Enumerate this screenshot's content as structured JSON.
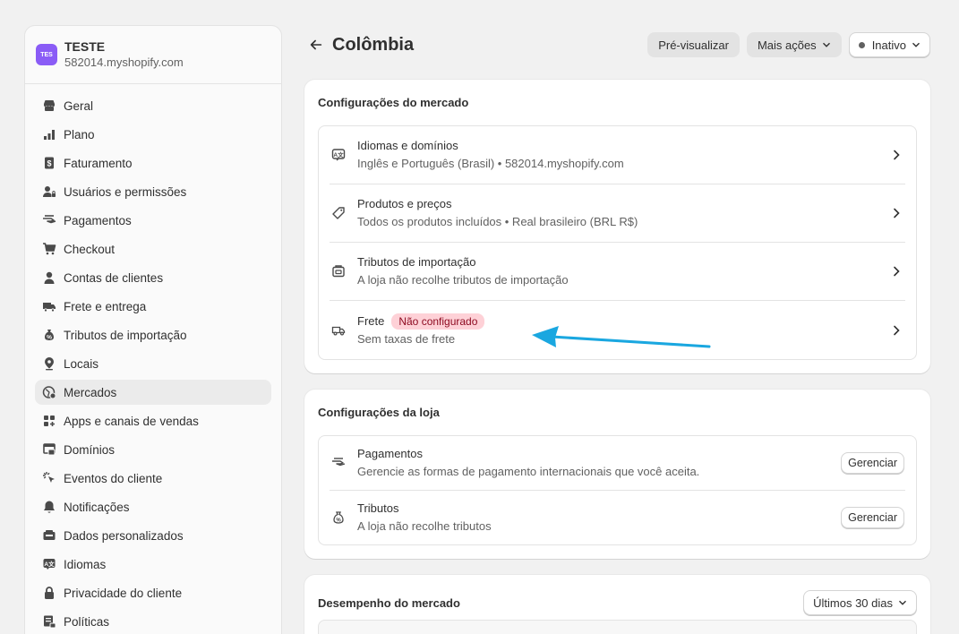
{
  "store": {
    "avatar": "TES",
    "name": "TESTE",
    "domain": "582014.myshopify.com"
  },
  "sidebar": {
    "items": [
      {
        "label": "Geral",
        "icon": "store-icon"
      },
      {
        "label": "Plano",
        "icon": "plan-icon"
      },
      {
        "label": "Faturamento",
        "icon": "billing-icon"
      },
      {
        "label": "Usuários e permissões",
        "icon": "users-icon"
      },
      {
        "label": "Pagamentos",
        "icon": "payments-icon"
      },
      {
        "label": "Checkout",
        "icon": "cart-icon"
      },
      {
        "label": "Contas de clientes",
        "icon": "person-icon"
      },
      {
        "label": "Frete e entrega",
        "icon": "truck-icon"
      },
      {
        "label": "Tributos de importação",
        "icon": "tax-icon"
      },
      {
        "label": "Locais",
        "icon": "location-icon"
      },
      {
        "label": "Mercados",
        "icon": "globe-icon",
        "active": true
      },
      {
        "label": "Apps e canais de vendas",
        "icon": "apps-icon"
      },
      {
        "label": "Domínios",
        "icon": "domain-icon"
      },
      {
        "label": "Eventos do cliente",
        "icon": "cursor-icon"
      },
      {
        "label": "Notificações",
        "icon": "bell-icon"
      },
      {
        "label": "Dados personalizados",
        "icon": "data-icon"
      },
      {
        "label": "Idiomas",
        "icon": "language-icon"
      },
      {
        "label": "Privacidade do cliente",
        "icon": "lock-icon"
      },
      {
        "label": "Políticas",
        "icon": "policy-icon"
      }
    ]
  },
  "header": {
    "title": "Colômbia",
    "preview_label": "Pré-visualizar",
    "more_actions_label": "Mais ações",
    "status_label": "Inativo"
  },
  "market_settings": {
    "title": "Configurações do mercado",
    "rows": [
      {
        "title": "Idiomas e domínios",
        "subtitle": "Inglês e Português (Brasil) • 582014.myshopify.com"
      },
      {
        "title": "Produtos e preços",
        "subtitle": "Todos os produtos incluídos • Real brasileiro (BRL R$)"
      },
      {
        "title": "Tributos de importação",
        "subtitle": "A loja não recolhe tributos de importação"
      },
      {
        "title": "Frete",
        "badge": "Não configurado",
        "subtitle": "Sem taxas de frete"
      }
    ]
  },
  "store_settings": {
    "title": "Configurações da loja",
    "rows": [
      {
        "title": "Pagamentos",
        "subtitle": "Gerencie as formas de pagamento internacionais que você aceita.",
        "button": "Gerenciar"
      },
      {
        "title": "Tributos",
        "subtitle": "A loja não recolhe tributos",
        "button": "Gerenciar"
      }
    ]
  },
  "performance": {
    "title": "Desempenho do mercado",
    "range_label": "Últimos 30 dias"
  },
  "colors": {
    "arrow": "#1aa7e0",
    "badge_bg": "#fed1d7",
    "badge_text": "#8e0b21",
    "avatar": "#8a5cf6"
  }
}
